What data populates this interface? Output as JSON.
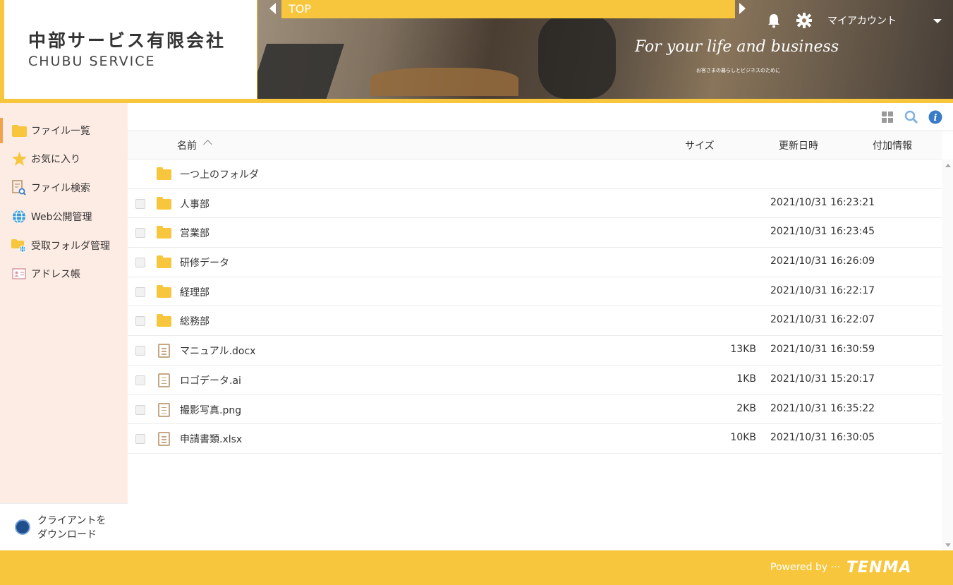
{
  "header": {
    "brand_title": "中部サービス有限会社",
    "brand_sub": "CHUBU SERVICE",
    "breadcrumb": "TOP",
    "tagline": "For your life and business",
    "tagline_sub": "お客さまの暮らしとビジネスのために",
    "account_label": "マイアカウント",
    "icons": [
      "bell-icon",
      "gear-icon"
    ]
  },
  "sidebar": {
    "items": [
      {
        "label": "ファイル一覧",
        "icon": "folder-icon",
        "active": true
      },
      {
        "label": "お気に入り",
        "icon": "star-icon"
      },
      {
        "label": "ファイル検索",
        "icon": "file-search-icon"
      },
      {
        "label": "Web公開管理",
        "icon": "globe-icon"
      },
      {
        "label": "受取フォルダ管理",
        "icon": "folder-globe-icon"
      },
      {
        "label": "アドレス帳",
        "icon": "address-card-icon"
      }
    ],
    "download_line1": "クライアントを",
    "download_line2": "ダウンロード"
  },
  "toolbar": {
    "icons": [
      "grid-view-icon",
      "search-icon",
      "info-icon"
    ]
  },
  "columns": {
    "name": "名前",
    "size": "サイズ",
    "updated": "更新日時",
    "extra": "付加情報"
  },
  "rows": [
    {
      "type": "parent",
      "name": "一つ上のフォルダ",
      "size": "",
      "date": ""
    },
    {
      "type": "folder",
      "name": "人事部",
      "size": "",
      "date": "2021/10/31 16:23:21"
    },
    {
      "type": "folder",
      "name": "営業部",
      "size": "",
      "date": "2021/10/31 16:23:45"
    },
    {
      "type": "folder",
      "name": "研修データ",
      "size": "",
      "date": "2021/10/31 16:26:09"
    },
    {
      "type": "folder",
      "name": "経理部",
      "size": "",
      "date": "2021/10/31 16:22:17"
    },
    {
      "type": "folder",
      "name": "総務部",
      "size": "",
      "date": "2021/10/31 16:22:07"
    },
    {
      "type": "file",
      "name": "マニュアル.docx",
      "size": "13KB",
      "date": "2021/10/31 16:30:59"
    },
    {
      "type": "file",
      "name": "ロゴデータ.ai",
      "size": "1KB",
      "date": "2021/10/31 15:20:17"
    },
    {
      "type": "file",
      "name": "撮影写真.png",
      "size": "2KB",
      "date": "2021/10/31 16:35:22"
    },
    {
      "type": "file",
      "name": "申請書類.xlsx",
      "size": "10KB",
      "date": "2021/10/31 16:30:05"
    }
  ],
  "footer": {
    "powered": "Powered by ···",
    "brand": "TENMA"
  },
  "colors": {
    "accent": "#f7c63d",
    "sidebar_bg": "#fdece4",
    "active_marker": "#f2a24b",
    "doc_icon": "#c5a786"
  }
}
